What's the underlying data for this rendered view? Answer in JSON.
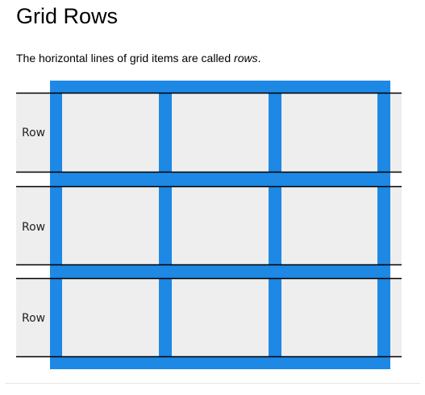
{
  "page": {
    "title": "Grid Rows",
    "intro_before": "The horizontal lines of grid items are called ",
    "intro_emphasis": "rows",
    "intro_after": "."
  },
  "diagram": {
    "rows": [
      {
        "label": "Row"
      },
      {
        "label": "Row"
      },
      {
        "label": "Row"
      }
    ],
    "columns": 3,
    "colors": {
      "grid_line": "#1e88e5",
      "cell": "#eeeeee",
      "row_band": "#eeeeee",
      "row_border": "#000000"
    }
  }
}
